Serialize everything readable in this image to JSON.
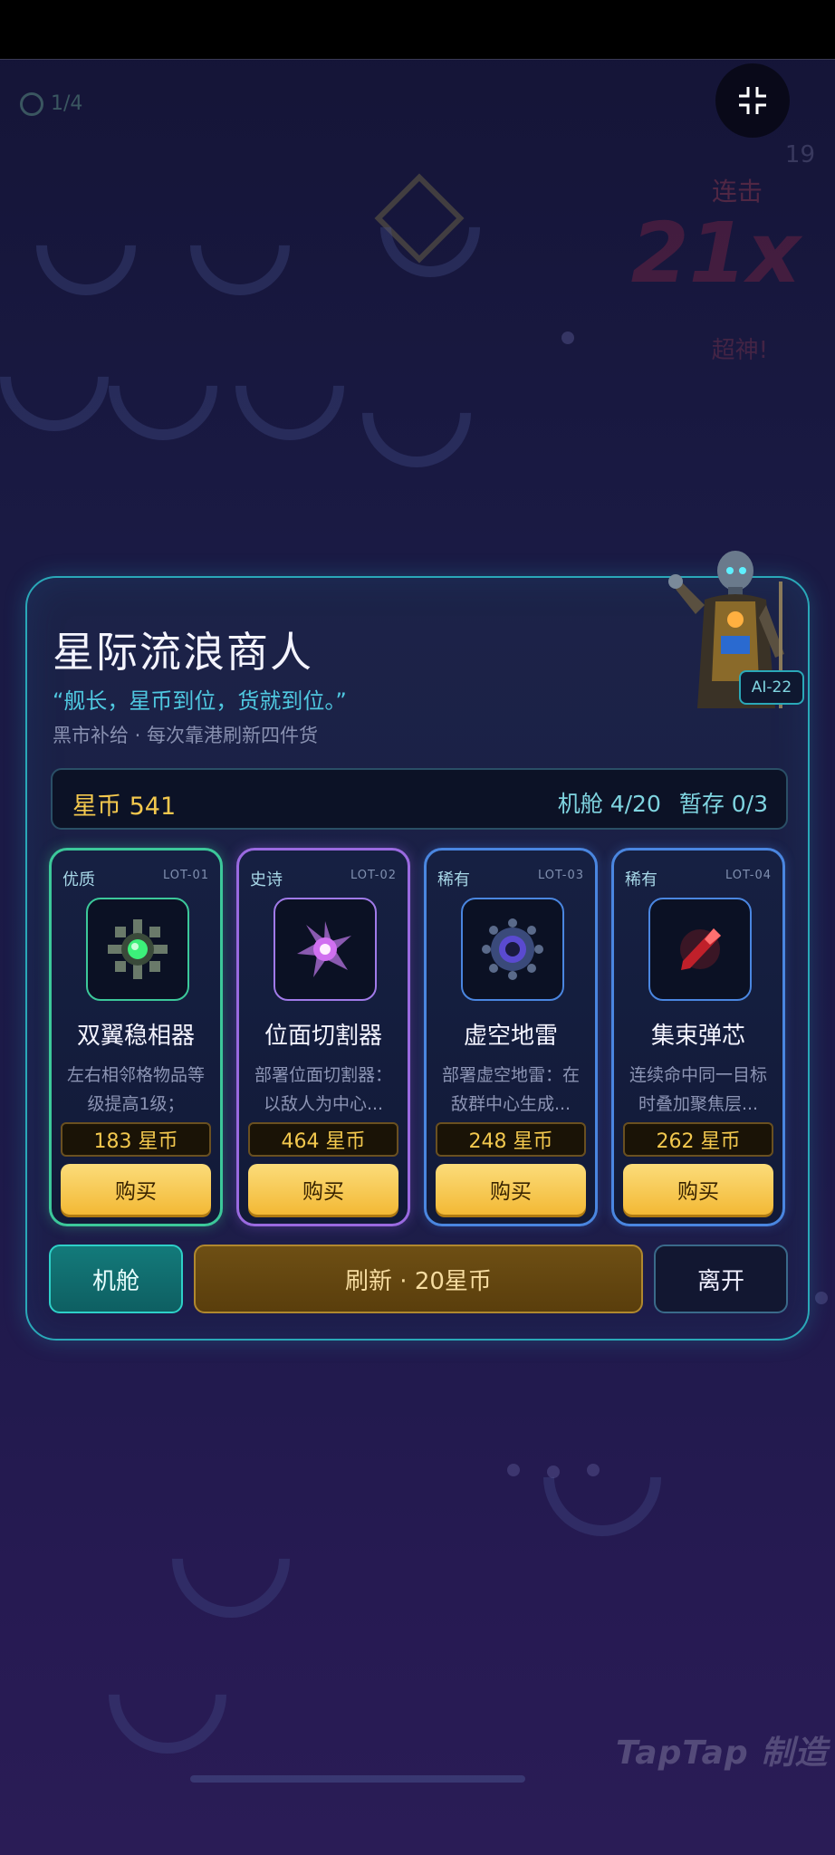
{
  "shop": {
    "title": "星际流浪商人",
    "quote": "“舰长，星币到位，货就到位。”",
    "subtitle": "黑市补给 · 每次靠港刷新四件货",
    "merchant_tag": "AI-22",
    "coins_label": "星币 541",
    "cabin_label": "机舱 4/20",
    "storage_label": "暂存 0/3"
  },
  "items": [
    {
      "rarity": "优质",
      "lot": "LOT-01",
      "name": "双翼稳相器",
      "desc": "左右相邻格物品等级提高1级；",
      "price": "183 星币",
      "buy": "购买",
      "icon": "green-gem-gear-icon"
    },
    {
      "rarity": "史诗",
      "lot": "LOT-02",
      "name": "位面切割器",
      "desc": "部署位面切割器：以敌人为中心...",
      "price": "464 星币",
      "buy": "购买",
      "icon": "purple-crystal-icon"
    },
    {
      "rarity": "稀有",
      "lot": "LOT-03",
      "name": "虚空地雷",
      "desc": "部署虚空地雷：在敌群中心生成...",
      "price": "248 星币",
      "buy": "购买",
      "icon": "blue-mine-icon"
    },
    {
      "rarity": "稀有",
      "lot": "LOT-04",
      "name": "集束弹芯",
      "desc": "连续命中同一目标时叠加聚焦层...",
      "price": "262 星币",
      "buy": "购买",
      "icon": "red-bullet-core-icon"
    }
  ],
  "actions": {
    "cabin": "机舱",
    "refresh": "刷新 · 20星币",
    "leave": "离开"
  },
  "background": {
    "wave": "1/4",
    "combo_label": "连击",
    "combo_value": "21x",
    "combo_sub": "超神!",
    "corner_num": "19"
  },
  "watermark": "TapTap 制造",
  "colors": {
    "panel_border": "#2aa8b8",
    "coin_gold": "#f3c84e",
    "buy_button": "#f3b935",
    "quote_cyan": "#4fc8e0"
  }
}
